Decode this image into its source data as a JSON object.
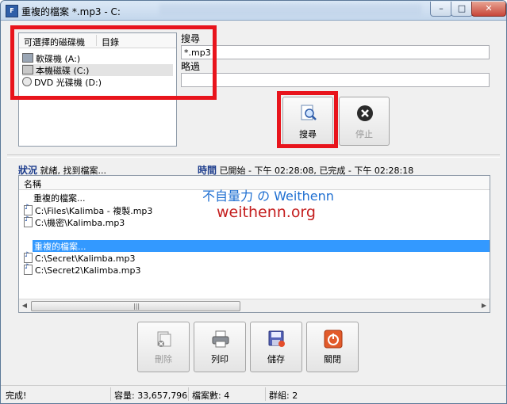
{
  "window": {
    "title": "重複的檔案 *.mp3 - C:",
    "minimize": "–",
    "maximize": "□",
    "close": "✕"
  },
  "drives": {
    "col_available": "可選擇的磁碟機",
    "col_directory": "目錄",
    "items": [
      {
        "label": "軟碟機 (A:)",
        "icon": "floppy-drive-icon"
      },
      {
        "label": "本機磁碟 (C:)",
        "icon": "hard-drive-icon",
        "selected": true
      },
      {
        "label": "DVD 光碟機 (D:)",
        "icon": "dvd-drive-icon"
      }
    ]
  },
  "search": {
    "search_label": "搜尋",
    "search_value": "*.mp3",
    "skip_label": "略過",
    "skip_value": ""
  },
  "buttons": {
    "search": "搜尋",
    "stop": "停止",
    "delete": "刪除",
    "print": "列印",
    "save": "儲存",
    "close": "關閉"
  },
  "status": {
    "status_label": "狀況",
    "status_text": "就緒, 找到檔案...",
    "time_label": "時間",
    "time_text": "已開始 - 下午 02:28:08, 已完成 - 下午 02:28:18"
  },
  "results": {
    "col_name": "名稱",
    "rows": [
      {
        "text": "重複的檔案...",
        "kind": "group"
      },
      {
        "text": "C:\\Files\\Kalimba - 複製.mp3",
        "kind": "file"
      },
      {
        "text": "C:\\機密\\Kalimba.mp3",
        "kind": "file"
      },
      {
        "text": "重複的檔案...",
        "kind": "group",
        "selected": true
      },
      {
        "text": "C:\\Secret\\Kalimba.mp3",
        "kind": "file"
      },
      {
        "text": "C:\\Secret2\\Kalimba.mp3",
        "kind": "file"
      }
    ]
  },
  "watermark": {
    "line1": "不自量力 の Weithenn",
    "line2": "weithenn.org"
  },
  "statusbar": {
    "state": "完成!",
    "capacity": "容量: 33,657,796",
    "file_count": "檔案數: 4",
    "groups": "群組: 2"
  },
  "colors": {
    "highlight": "#e8141c",
    "selection": "#3399ff",
    "accent_blue": "#1c3c8c"
  }
}
